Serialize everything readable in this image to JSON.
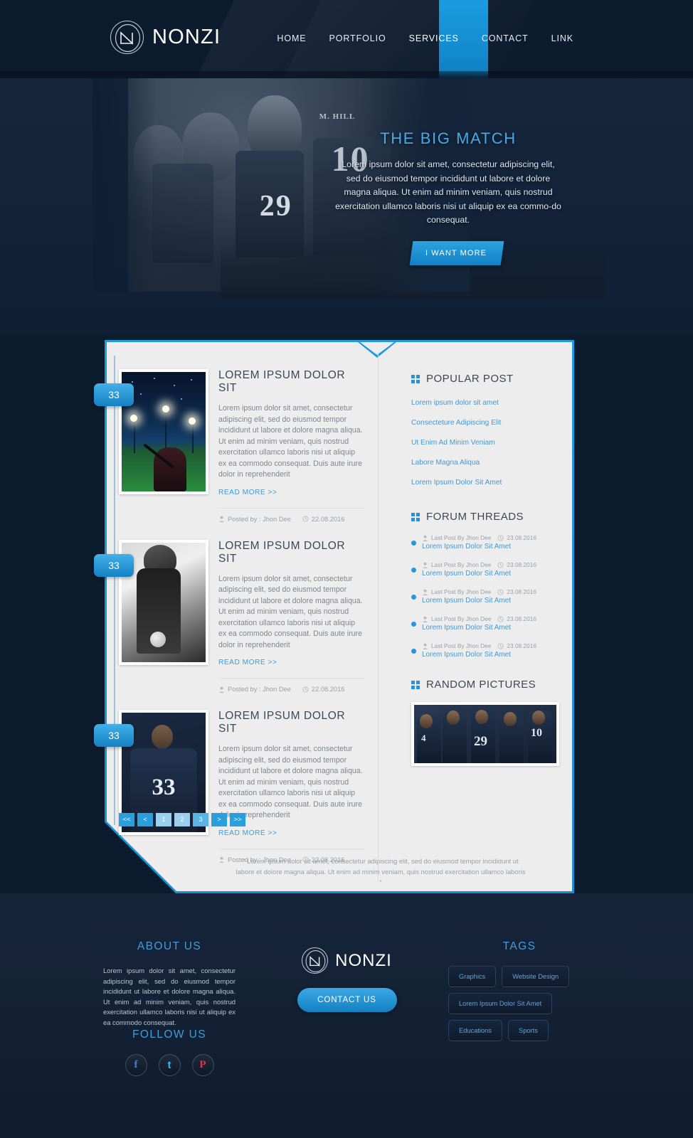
{
  "header": {
    "brand": "NONZI",
    "logo_icon": "nonzi-monogram-icon",
    "nav": [
      {
        "label": "HOME",
        "active": false
      },
      {
        "label": "PORTFOLIO",
        "active": false
      },
      {
        "label": "SERVICES",
        "active": true
      },
      {
        "label": "CONTACT",
        "active": false
      },
      {
        "label": "LINK",
        "active": false
      }
    ]
  },
  "hero": {
    "title": "THE BIG MATCH",
    "text": "Lorem ipsum dolor sit amet, consectetur adipiscing elit, sed do eiusmod tempor incididunt ut labore et dolore magna aliqua. Ut enim ad minim veniam, quis nostrud exercitation ullamco laboris nisi ut aliquip ex ea commo-do consequat.",
    "button": "I WANT MORE",
    "photo_number": "29",
    "photo_number_2": "10",
    "photo_name": "M. HILL"
  },
  "posts": [
    {
      "badge": "33",
      "title": "LOREM IPSUM DOLOR SIT",
      "text": "Lorem ipsum dolor sit amet, consectetur adipiscing elit, sed do eiusmod tempor incididunt ut labore et dolore magna aliqua. Ut enim ad minim veniam, quis nostrud exercitation ullamco laboris nisi ut aliquip ex ea commodo consequat. Duis aute irure dolor in reprehenderit",
      "more": "READ MORE >>",
      "author": "Posted by : Jhon Dee",
      "date": "22.08.2016",
      "thumb": "baseball-night-field-image"
    },
    {
      "badge": "33",
      "title": "LOREM IPSUM DOLOR SIT",
      "text": "Lorem ipsum dolor sit amet, consectetur adipiscing elit, sed do eiusmod tempor incididunt ut labore et dolore magna aliqua. Ut enim ad minim veniam, quis nostrud exercitation ullamco laboris nisi ut aliquip ex ea commodo consequat. Duis aute irure dolor in reprehenderit",
      "more": "READ MORE >>",
      "author": "Posted by : Jhon Dee",
      "date": "22.08.2016",
      "thumb": "softball-player-bw-image"
    },
    {
      "badge": "33",
      "title": "LOREM IPSUM DOLOR SIT",
      "text": "Lorem ipsum dolor sit amet, consectetur adipiscing elit, sed do eiusmod tempor incididunt ut labore et dolore magna aliqua. Ut enim ad minim veniam, quis nostrud exercitation ullamco laboris nisi ut aliquip ex ea commodo consequat. Duis aute irure dolor in reprehenderit",
      "more": "READ MORE >>",
      "author": "Posted by : Jhon Dee",
      "date": "22.08.2016",
      "thumb": "football-player-29-image"
    }
  ],
  "pagination": [
    "<<",
    "<",
    "1",
    "2",
    "3",
    ">",
    ">>"
  ],
  "quote": "“ Lorem ipsum dolor sit amet, consectetur adipiscing elit, sed do eiusmod tempor incididunt ut labore et dolore magna aliqua. Ut enim ad minim veniam, quis nostrud exercitation ullamco laboris ”",
  "sidebar": {
    "popular": {
      "heading": "POPULAR POST",
      "items": [
        "Lorem ipsum dolor sit amet",
        "Consecteture Adipiscing Elit",
        "Ut Enim Ad Minim Veniam",
        "Labore Magna Aliqua",
        "Lorem Ipsum Dolor Sit Amet"
      ]
    },
    "forum": {
      "heading": "FORUM THREADS",
      "items": [
        {
          "meta": "Last Post By Jhon Dee",
          "date": "23.08.2016",
          "title": "Lorem Ipsum Dolor Sit Amet"
        },
        {
          "meta": "Last Post By Jhon Dee",
          "date": "23.08.2016",
          "title": "Lorem Ipsum Dolor Sit Amet"
        },
        {
          "meta": "Last Post By Jhon Dee",
          "date": "23.08.2016",
          "title": "Lorem Ipsum Dolor Sit Amet"
        },
        {
          "meta": "Last Post By Jhon Dee",
          "date": "23.08.2016",
          "title": "Lorem Ipsum Dolor Sit Amet"
        },
        {
          "meta": "Last Post By Jhon Dee",
          "date": "23.08.2016",
          "title": "Lorem Ipsum Dolor Sit Amet"
        }
      ]
    },
    "random": {
      "heading": "RANDOM PICTURES",
      "image": "football-team-huddle-image",
      "jersey_numbers": [
        "4",
        "29",
        "10"
      ]
    }
  },
  "footer": {
    "about": {
      "heading": "ABOUT US",
      "text": "Lorem ipsum dolor sit amet, consectetur adipiscing elit, sed do eiusmod tempor incididunt ut labore et dolore magna aliqua. Ut enim ad minim veniam, quis nostrud exercitation ullamco laboris nisi ut aliquip ex ea commodo consequat."
    },
    "follow": {
      "heading": "FOLLOW US",
      "socials": [
        {
          "name": "facebook-icon",
          "glyph": "f",
          "color": "#4a7ed4"
        },
        {
          "name": "twitter-icon",
          "glyph": "t",
          "color": "#3fb7ef"
        },
        {
          "name": "pinterest-icon",
          "glyph": "P",
          "color": "#d2394a"
        }
      ]
    },
    "brand": "NONZI",
    "contact_button": "CONTACT US",
    "tags": {
      "heading": "TAGS",
      "items": [
        "Graphics",
        "Website Design",
        "Lorem Ipsum Dolor Sit Amet",
        "Educations",
        "Sports"
      ]
    }
  },
  "colors": {
    "accent": "#2a9fdd",
    "accent_light": "#46a9e8",
    "dark_bg": "#101f33",
    "card_bg": "#ededed"
  }
}
